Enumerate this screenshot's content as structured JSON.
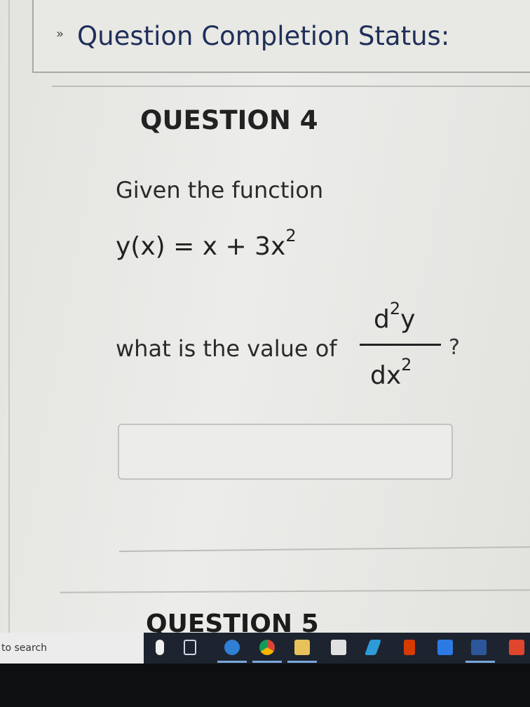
{
  "status": {
    "title": "Question Completion Status:"
  },
  "question": {
    "title": "QUESTION 4",
    "intro": "Given the function",
    "function_lhs": "y(x) = x + 3x",
    "function_exp": "2",
    "prompt": "what is the value of",
    "frac_num_base": "d",
    "frac_num_exp": "2",
    "frac_num_tail": "y",
    "frac_den_base": "dx",
    "frac_den_exp": "2",
    "qmark": "?",
    "answer": {
      "value": ""
    }
  },
  "next_question": {
    "title": "QUESTION 5"
  },
  "taskbar": {
    "search_text": "to search",
    "icons": [
      {
        "name": "mic-icon",
        "color": "#f0f0f0"
      },
      {
        "name": "task-view-icon",
        "color": "#cfd6e0"
      },
      {
        "name": "edge-icon",
        "color": "#2f7fd4"
      },
      {
        "name": "chrome-icon",
        "color": "#f2b01e"
      },
      {
        "name": "file-explorer-icon",
        "color": "#e9c15a"
      },
      {
        "name": "store-icon",
        "color": "#e0e0e0"
      },
      {
        "name": "app-icon",
        "color": "#2e9bd8"
      },
      {
        "name": "office-icon",
        "color": "#d83b01"
      },
      {
        "name": "mail-icon",
        "color": "#2c7be5"
      },
      {
        "name": "word-icon",
        "color": "#2b579a"
      },
      {
        "name": "app-red-icon",
        "color": "#e0452d"
      }
    ]
  }
}
